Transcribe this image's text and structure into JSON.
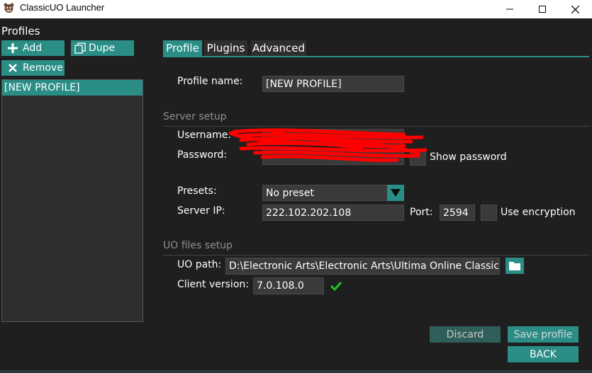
{
  "window": {
    "title": "ClassicUO Launcher",
    "controls": {
      "minimize": "—",
      "maximize": "☐",
      "close": "✕"
    }
  },
  "profiles": {
    "heading": "Profiles",
    "add_label": "Add",
    "dupe_label": "Dupe",
    "remove_label": "Remove",
    "items": [
      "[NEW PROFILE]"
    ]
  },
  "tabs": [
    {
      "label": "Profile",
      "active": true
    },
    {
      "label": "Plugins",
      "active": false
    },
    {
      "label": "Advanced",
      "active": false
    }
  ],
  "profile_form": {
    "profile_name_label": "Profile name:",
    "profile_name_value": "[NEW PROFILE]",
    "server_setup_title": "Server setup",
    "username_label": "Username:",
    "password_label": "Password:",
    "show_password_label": "Show password",
    "presets_label": "Presets:",
    "presets_value": "No preset",
    "server_ip_label": "Server IP:",
    "server_ip_value": "222.102.202.108",
    "port_label": "Port:",
    "port_value": "2594",
    "use_encryption_label": "Use encryption",
    "uo_files_title": "UO files setup",
    "uo_path_label": "UO path:",
    "uo_path_value": "D:\\Electronic Arts\\Electronic Arts\\Ultima Online Classic",
    "client_version_label": "Client version:",
    "client_version_value": "7.0.108.0"
  },
  "actions": {
    "discard_label": "Discard",
    "save_label": "Save profile",
    "back_label": "BACK"
  },
  "colors": {
    "accent": "#2a8e86",
    "background": "#1f1f1f",
    "input_bg": "#3a3a3a",
    "redaction": "#ff0000",
    "valid_check": "#22c51e"
  },
  "icons": [
    "app-icon",
    "plus-icon",
    "copy-icon",
    "x-icon",
    "dropdown-arrow-icon",
    "folder-icon",
    "check-icon"
  ]
}
